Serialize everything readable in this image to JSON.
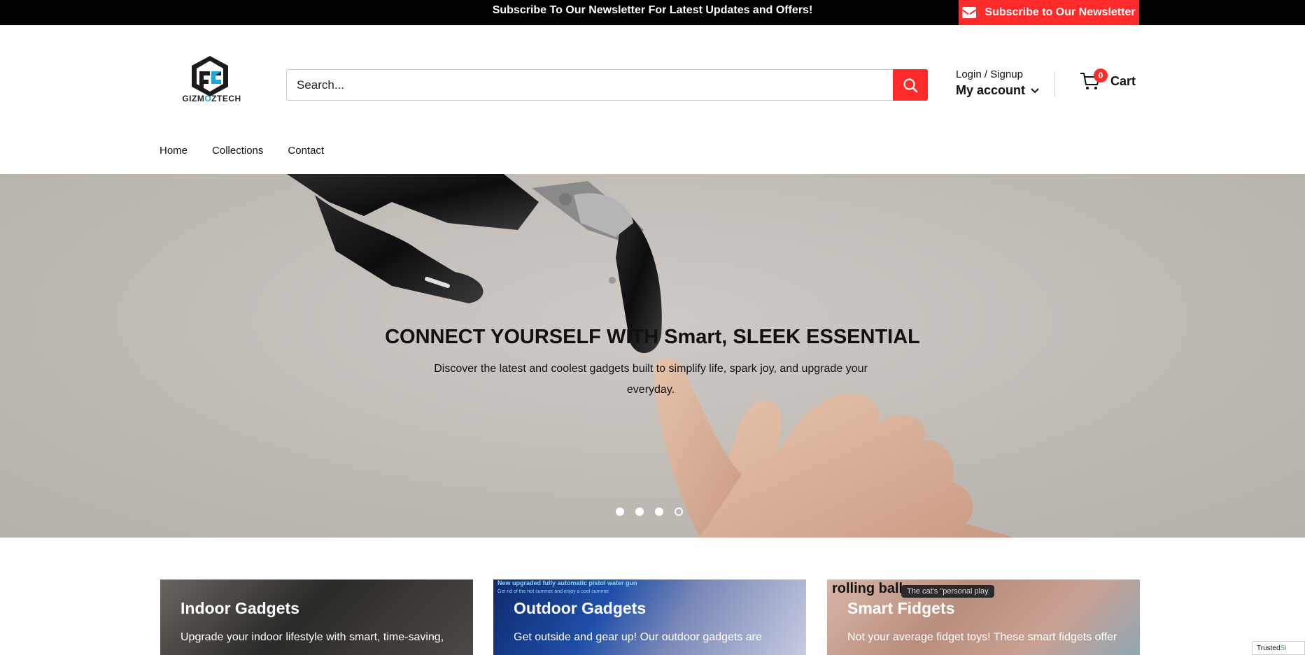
{
  "announcement": {
    "text": "Subscribe To Our Newsletter For Latest Updates and Offers!",
    "button_label": "Subscribe to Our Newsletter"
  },
  "brand": {
    "logo_text_a": "GIZM",
    "logo_text_o": "O",
    "logo_text_b": "ZTECH"
  },
  "search": {
    "placeholder": "Search..."
  },
  "account": {
    "login_label": "Login / Signup",
    "my_account_label": "My account"
  },
  "cart": {
    "count": "0",
    "label": "Cart"
  },
  "nav": {
    "items": [
      {
        "label": "Home"
      },
      {
        "label": "Collections"
      },
      {
        "label": "Contact"
      }
    ]
  },
  "hero": {
    "title": "CONNECT YOURSELF WITH Smart, SLEEK ESSENTIAL",
    "subtitle": "Discover the latest and coolest gadgets built to simplify life, spark joy, and upgrade your everyday."
  },
  "categories": [
    {
      "title": "Indoor Gadgets",
      "description": "Upgrade your indoor lifestyle with smart, time-saving,"
    },
    {
      "title": "Outdoor Gadgets",
      "description": "Get outside and gear up! Our outdoor gadgets are",
      "image_text_1": "New upgraded fully automatic pistol water gun",
      "image_text_2": "Get rid of the hot summer and enjoy a cool summer"
    },
    {
      "title": "Smart Fidgets",
      "description": "Not your average fidget toys! These smart fidgets offer",
      "image_text_1": "rolling ball",
      "image_text_2": "The cat's \"personal play"
    }
  ],
  "badge": {
    "text_a": "Trusted",
    "text_b": "Si"
  },
  "colors": {
    "accent": "#ff2b2b",
    "topbar": "#000000",
    "logo_accent": "#1ca7d9"
  }
}
